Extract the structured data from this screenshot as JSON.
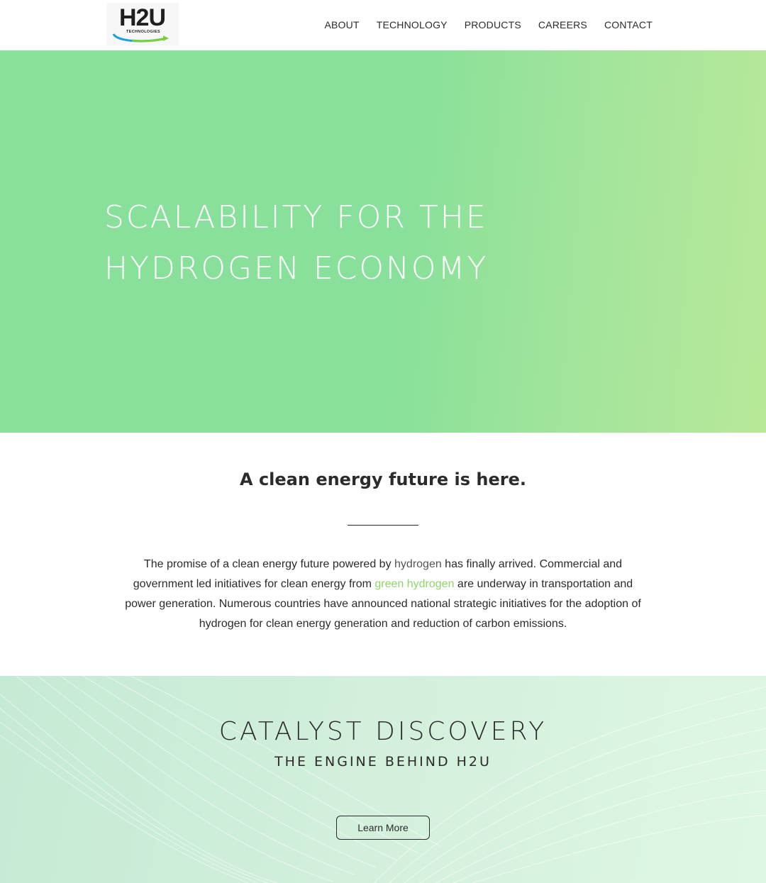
{
  "brand": {
    "logo_text": "H2U",
    "logo_subtext": "TECHNOLOGIES"
  },
  "nav": {
    "items": [
      "ABOUT",
      "TECHNOLOGY",
      "PRODUCTS",
      "CAREERS",
      "CONTACT"
    ]
  },
  "hero": {
    "title": "SCALABILITY FOR THE\nHYDROGEN ECONOMY"
  },
  "intro": {
    "heading": "A clean energy future is here.",
    "paragraph": {
      "part1": "The promise of a clean energy future powered by ",
      "link_hydrogen": "hydrogen",
      "part2": " has finally arrived. Commercial and government led initiatives for clean energy from ",
      "link_green": "green hydrogen",
      "part3": " are underway in transportation and power generation. Numerous countries have announced national strategic initiatives for the adoption of hydrogen for clean energy generation and reduction of carbon emissions."
    }
  },
  "catalyst": {
    "title": "CATALYST DISCOVERY",
    "subtitle": "THE ENGINE BEHIND H2U",
    "button_label": "Learn More"
  },
  "colors": {
    "hero_green": "#88e09a",
    "accent_green": "#8dd66a",
    "text": "#2b2b2b"
  }
}
